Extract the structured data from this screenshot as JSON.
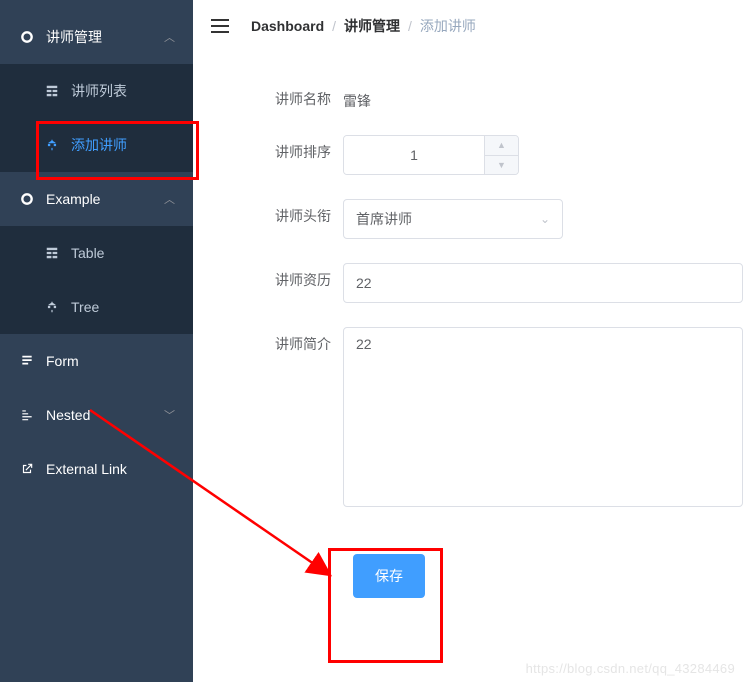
{
  "sidebar": {
    "groups": [
      {
        "label": "讲师管理",
        "expanded": true,
        "children": [
          {
            "label": "讲师列表",
            "icon": "table"
          },
          {
            "label": "添加讲师",
            "icon": "tree",
            "active": true
          }
        ]
      },
      {
        "label": "Example",
        "expanded": true,
        "children": [
          {
            "label": "Table",
            "icon": "table"
          },
          {
            "label": "Tree",
            "icon": "tree"
          }
        ]
      },
      {
        "label": "Form",
        "icon": "form"
      },
      {
        "label": "Nested",
        "icon": "nested",
        "collapsible": true
      },
      {
        "label": "External Link",
        "icon": "link"
      }
    ]
  },
  "breadcrumb": {
    "items": [
      "Dashboard",
      "讲师管理",
      "添加讲师"
    ]
  },
  "form": {
    "name": {
      "label": "讲师名称",
      "value": "雷锋"
    },
    "sort": {
      "label": "讲师排序",
      "value": "1"
    },
    "title": {
      "label": "讲师头衔",
      "value": "首席讲师"
    },
    "resume": {
      "label": "讲师资历",
      "value": "22"
    },
    "intro": {
      "label": "讲师简介",
      "value": "22"
    },
    "save": "保存"
  },
  "watermark": "https://blog.csdn.net/qq_43284469"
}
